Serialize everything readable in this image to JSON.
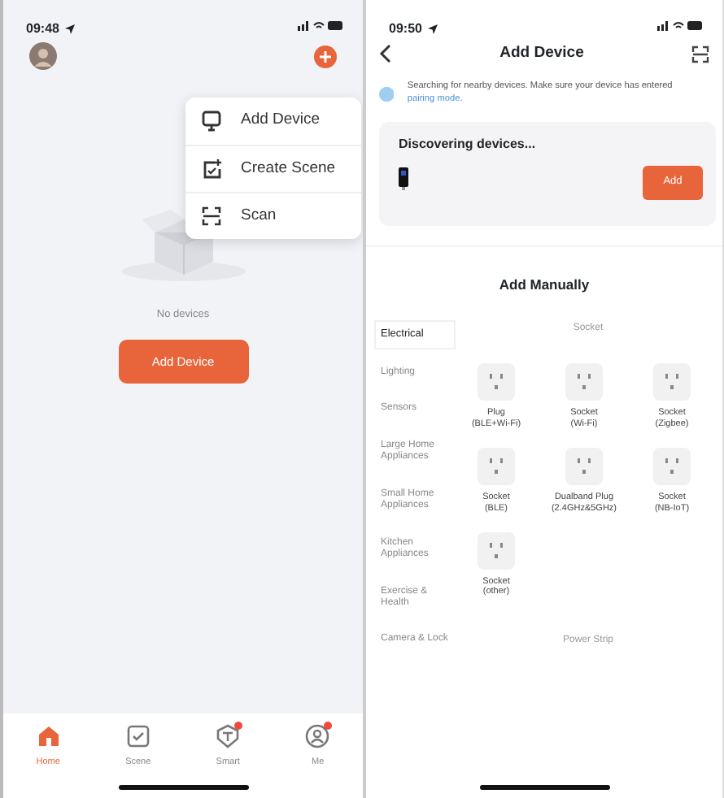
{
  "home_screen": {
    "status_bar": {
      "time": "09:48"
    },
    "menu": {
      "items": [
        {
          "kind": "add",
          "label": "Add Device"
        },
        {
          "kind": "scene",
          "label": "Create Scene"
        },
        {
          "kind": "scan",
          "label": "Scan"
        }
      ]
    },
    "empty_text": "No devices",
    "add_button": "Add Device",
    "tab_bar": [
      {
        "kind": "home",
        "label": "Home",
        "selected": true,
        "badge": false
      },
      {
        "kind": "scene",
        "label": "Scene",
        "selected": false,
        "badge": false
      },
      {
        "kind": "smart",
        "label": "Smart",
        "selected": false,
        "badge": true
      },
      {
        "kind": "me",
        "label": "Me",
        "selected": false,
        "badge": true
      }
    ]
  },
  "add_device_screen": {
    "status_bar": {
      "time": "09:50"
    },
    "title": "Add Device",
    "notice": "Searching for nearby devices. Make sure your device has entered",
    "notice_link": "pairing mode.",
    "discovering": {
      "title": "Discovering devices...",
      "button": "Add"
    },
    "section_title": "Add Manually",
    "categories": [
      {
        "label": "Electrical",
        "selected": true
      },
      {
        "label": "Lighting",
        "selected": false
      },
      {
        "label": "Sensors",
        "selected": false
      },
      {
        "label": "Large Home Appliances",
        "selected": false
      },
      {
        "label": "Small Home Appliances",
        "selected": false
      },
      {
        "label": "Kitchen Appliances",
        "selected": false
      },
      {
        "label": "Exercise & Health",
        "selected": false
      },
      {
        "label": "Camera & Lock",
        "selected": false
      }
    ],
    "groups": [
      {
        "title": "Socket",
        "devices": [
          {
            "line1": "Plug",
            "line2": "(BLE+Wi-Fi)"
          },
          {
            "line1": "Socket",
            "line2": "(Wi-Fi)"
          },
          {
            "line1": "Socket",
            "line2": "(Zigbee)"
          },
          {
            "line1": "Socket",
            "line2": "(BLE)"
          },
          {
            "line1": "Dualband Plug",
            "line2": "(2.4GHz&5GHz)"
          },
          {
            "line1": "Socket",
            "line2": "(NB-IoT)"
          },
          {
            "line1": "Socket",
            "line2": "(other)"
          }
        ]
      },
      {
        "title": "Power Strip"
      }
    ]
  }
}
